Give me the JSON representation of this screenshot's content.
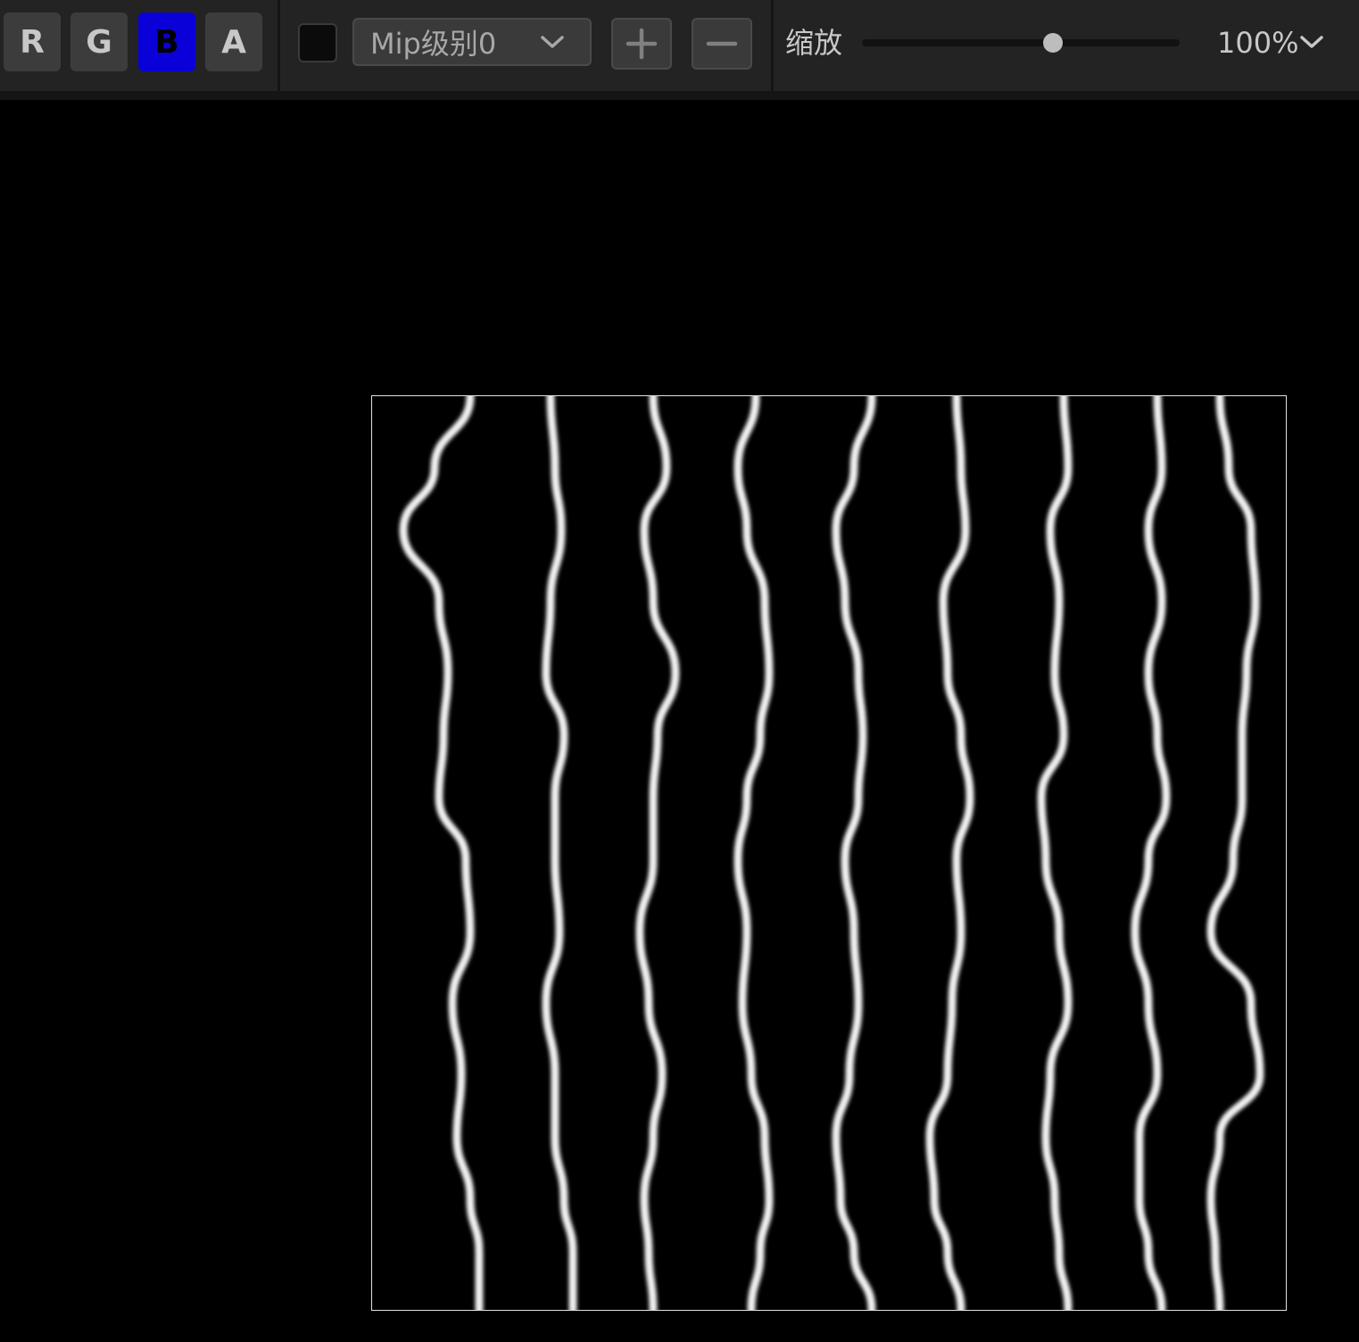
{
  "toolbar": {
    "channels": [
      {
        "label": "R",
        "active": false
      },
      {
        "label": "G",
        "active": false
      },
      {
        "label": "B",
        "active": true
      },
      {
        "label": "A",
        "active": false
      }
    ],
    "active_channel_color": "#0a00d8",
    "mip_select": {
      "value": "Mip级别0",
      "icon": "chevron-down-icon"
    },
    "zoom_in_icon": "plus-icon",
    "zoom_out_icon": "minus-icon",
    "zoom": {
      "label": "缩放",
      "value": "100%",
      "slider_level": 0.6,
      "icon": "chevron-down-icon"
    }
  },
  "texture": {
    "description_icon": "texture-preview",
    "line_color": "#f2f2f2",
    "background_color": "#000000"
  }
}
